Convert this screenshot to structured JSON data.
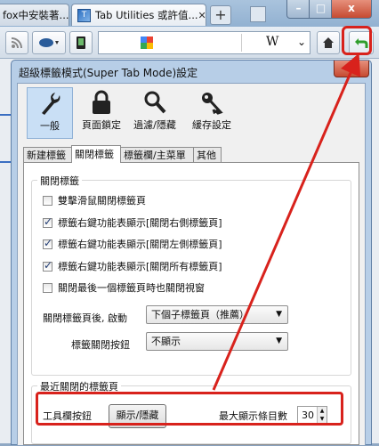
{
  "browser": {
    "tabs": [
      {
        "label": "fox中安裝著..."
      },
      {
        "label": "Tab Utilities 或許值...",
        "active": true
      }
    ],
    "new_tab": "+",
    "search_logo": "W",
    "window_buttons": {
      "min": "–",
      "max": "□",
      "close": "x"
    }
  },
  "dialog": {
    "title": "超級標籤模式(Super Tab Mode)設定",
    "close": "x",
    "panes": [
      {
        "label": "一般",
        "icon": "wrench-icon",
        "selected": true
      },
      {
        "label": "頁面鎖定",
        "icon": "lock-icon"
      },
      {
        "label": "過濾/隱藏",
        "icon": "magnifier-icon"
      },
      {
        "label": "緩存設定",
        "icon": "key-icon"
      }
    ],
    "tabs": [
      {
        "label": "新建標籤"
      },
      {
        "label": "關閉標籤",
        "active": true
      },
      {
        "label": "標籤欄/主菜單"
      },
      {
        "label": "其他"
      }
    ],
    "close_group": {
      "title": "關閉標籤",
      "checks": [
        {
          "label": "雙擊滑鼠關閉標籤頁",
          "checked": false
        },
        {
          "label": "標籤右鍵功能表顯示[關閉右側標籤頁]",
          "checked": true
        },
        {
          "label": "標籤右鍵功能表顯示[關閉左側標籤頁]",
          "checked": true
        },
        {
          "label": "標籤右鍵功能表顯示[關閉所有標籤頁]",
          "checked": true
        },
        {
          "label": "關閉最後一個標籤頁時也關閉視窗",
          "checked": false
        }
      ],
      "after_close_label": "關閉標籤頁後, 啟動",
      "after_close_value": "下個子標籤頁（推薦）",
      "close_button_label": "標籤關閉按鈕",
      "close_button_value": "不顯示"
    },
    "recent_group": {
      "title": "最近關閉的標籤頁",
      "toolbar_label": "工具欄按鈕",
      "toolbar_button": "顯示/隱藏",
      "max_label": "最大顯示條目數",
      "max_value": "30"
    }
  },
  "colors": {
    "highlight": "#d8221c",
    "undo_green": "#2f9d2b"
  }
}
